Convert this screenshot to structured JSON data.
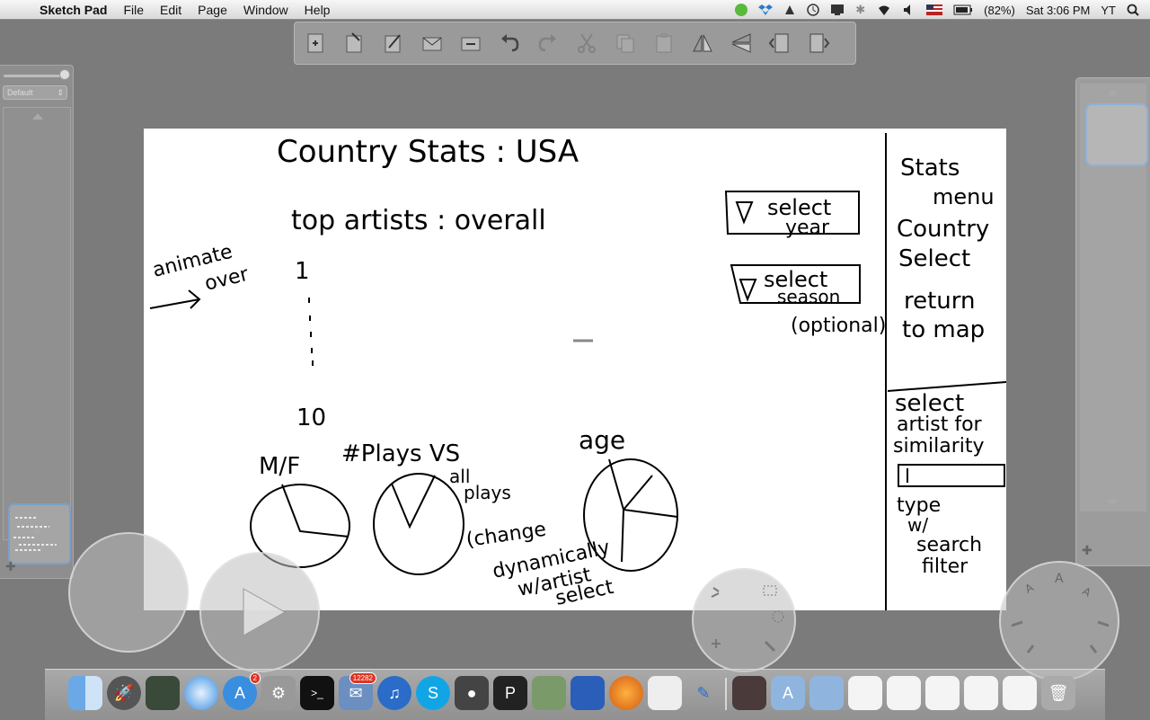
{
  "menubar": {
    "app_name": "Sketch Pad",
    "menus": [
      "File",
      "Edit",
      "Page",
      "Window",
      "Help"
    ],
    "battery": "(82%)",
    "clock": "Sat 3:06 PM",
    "user": "YT"
  },
  "left_panel": {
    "preset": "Default"
  },
  "canvas": {
    "title": "Country Stats : USA",
    "subtitle": "top artists : overall",
    "rank_first": "1",
    "rank_last": "10",
    "animate_note": [
      "animate",
      "over"
    ],
    "select_year": [
      "select",
      "year"
    ],
    "select_season": [
      "select",
      "season"
    ],
    "optional": "(optional)",
    "sidebar_menu": [
      "Stats",
      "menu",
      "Country",
      "Select",
      "return",
      "to map"
    ],
    "artist_select": [
      "select",
      "artist for",
      "similarity"
    ],
    "search_note": [
      "type",
      "w/",
      "search",
      "filter"
    ],
    "pie_mf": "M/F",
    "pie_plays": "#Plays VS",
    "pie_plays_2": [
      "all",
      "plays"
    ],
    "pie_age": "age",
    "change_note": [
      "(change",
      "dynamically",
      "w/artist",
      "select"
    ]
  },
  "dock": {
    "mail_badge": "12282",
    "appstore_badge": "2"
  }
}
